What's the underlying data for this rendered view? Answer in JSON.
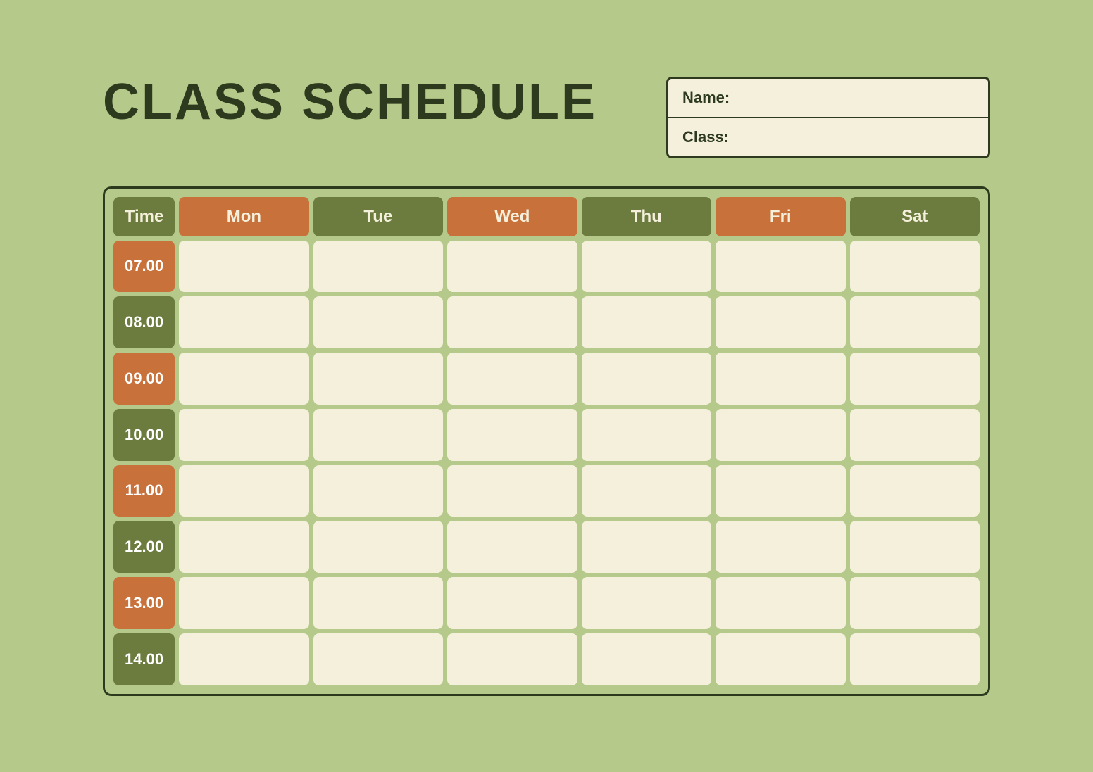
{
  "page": {
    "background_color": "#b5c98a"
  },
  "header": {
    "title": "CLASS SCHEDULE",
    "info_labels": {
      "name": "Name:",
      "class": "Class:"
    }
  },
  "schedule": {
    "columns": [
      "Time",
      "Mon",
      "Tue",
      "Wed",
      "Thu",
      "Fri",
      "Sat"
    ],
    "time_slots": [
      "07.00",
      "08.00",
      "09.00",
      "10.00",
      "11.00",
      "12.00",
      "13.00",
      "14.00"
    ]
  }
}
